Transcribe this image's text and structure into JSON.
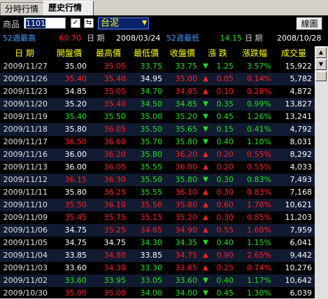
{
  "tabs": [
    {
      "label": "分時行情"
    },
    {
      "label": "歷史行情"
    }
  ],
  "toolbar": {
    "product_label": "商品",
    "code_value": "1101",
    "name_value": "台泥",
    "chart_button": "線圖"
  },
  "stats": {
    "high52_label": "52週最高",
    "high52_value": "60.70",
    "high52_date_label": "日  期",
    "high52_date": "2008/03/24",
    "low52_label": "52週最低",
    "low52_value": "14.15",
    "low52_date_label": "日  期",
    "low52_date": "2008/10/28"
  },
  "columns": [
    "日  期",
    "開盤價",
    "最高價",
    "最低價",
    "收盤價",
    "漲  跌",
    "漲跌幅",
    "成交量"
  ],
  "rows": [
    {
      "date": "2009/11/27",
      "open": "35.00",
      "open_c": "w",
      "high": "35.05",
      "high_c": "r",
      "low": "33.75",
      "low_c": "g",
      "close": "33.75",
      "close_c": "g",
      "dir": "down",
      "chg": "1.25",
      "pct": "3.57%",
      "vol": "15,922"
    },
    {
      "date": "2009/11/26",
      "open": "35.40",
      "open_c": "r",
      "high": "35.40",
      "high_c": "r",
      "low": "34.95",
      "low_c": "w",
      "close": "35.00",
      "close_c": "r",
      "dir": "up",
      "chg": "0.05",
      "pct": "0.14%",
      "vol": "5,782"
    },
    {
      "date": "2009/11/23",
      "open": "34.85",
      "open_c": "w",
      "high": "35.05",
      "high_c": "r",
      "low": "34.70",
      "low_c": "g",
      "close": "34.95",
      "close_c": "r",
      "dir": "up",
      "chg": "0.10",
      "pct": "0.28%",
      "vol": "4,872"
    },
    {
      "date": "2009/11/20",
      "open": "35.20",
      "open_c": "w",
      "high": "35.40",
      "high_c": "r",
      "low": "34.50",
      "low_c": "g",
      "close": "34.85",
      "close_c": "g",
      "dir": "down",
      "chg": "0.35",
      "pct": "0.99%",
      "vol": "13,827"
    },
    {
      "date": "2009/11/19",
      "open": "35.40",
      "open_c": "g",
      "high": "35.50",
      "high_c": "g",
      "low": "35.00",
      "low_c": "g",
      "close": "35.20",
      "close_c": "g",
      "dir": "down",
      "chg": "0.45",
      "pct": "1.26%",
      "vol": "13,241"
    },
    {
      "date": "2009/11/18",
      "open": "35.80",
      "open_c": "w",
      "high": "36.05",
      "high_c": "r",
      "low": "35.50",
      "low_c": "g",
      "close": "35.65",
      "close_c": "g",
      "dir": "down",
      "chg": "0.15",
      "pct": "0.41%",
      "vol": "4,792"
    },
    {
      "date": "2009/11/17",
      "open": "36.50",
      "open_c": "r",
      "high": "36.60",
      "high_c": "r",
      "low": "35.70",
      "low_c": "g",
      "close": "35.80",
      "close_c": "g",
      "dir": "down",
      "chg": "0.40",
      "pct": "1.10%",
      "vol": "8,031"
    },
    {
      "date": "2009/11/16",
      "open": "36.00",
      "open_c": "w",
      "high": "36.20",
      "high_c": "r",
      "low": "35.80",
      "low_c": "g",
      "close": "36.20",
      "close_c": "r",
      "dir": "up",
      "chg": "0.20",
      "pct": "0.55%",
      "vol": "8,292"
    },
    {
      "date": "2009/11/13",
      "open": "36.00",
      "open_c": "w",
      "high": "36.05",
      "high_c": "r",
      "low": "35.55",
      "low_c": "g",
      "close": "36.00",
      "close_c": "r",
      "dir": "up",
      "chg": "0.20",
      "pct": "0.55%",
      "vol": "4,033"
    },
    {
      "date": "2009/11/12",
      "open": "36.15",
      "open_c": "r",
      "high": "36.30",
      "high_c": "r",
      "low": "35.50",
      "low_c": "g",
      "close": "35.80",
      "close_c": "g",
      "dir": "down",
      "chg": "0.30",
      "pct": "0.83%",
      "vol": "7,493"
    },
    {
      "date": "2009/11/11",
      "open": "35.80",
      "open_c": "w",
      "high": "36.25",
      "high_c": "r",
      "low": "35.55",
      "low_c": "g",
      "close": "36.10",
      "close_c": "r",
      "dir": "up",
      "chg": "0.30",
      "pct": "0.83%",
      "vol": "7,168"
    },
    {
      "date": "2009/11/10",
      "open": "35.50",
      "open_c": "r",
      "high": "36.10",
      "high_c": "r",
      "low": "35.50",
      "low_c": "r",
      "close": "35.80",
      "close_c": "r",
      "dir": "up",
      "chg": "0.60",
      "pct": "1.70%",
      "vol": "10,621"
    },
    {
      "date": "2009/11/09",
      "open": "35.45",
      "open_c": "r",
      "high": "35.75",
      "high_c": "r",
      "low": "35.15",
      "low_c": "r",
      "close": "35.20",
      "close_c": "r",
      "dir": "up",
      "chg": "0.30",
      "pct": "0.85%",
      "vol": "11,203"
    },
    {
      "date": "2009/11/06",
      "open": "34.75",
      "open_c": "w",
      "high": "35.25",
      "high_c": "r",
      "low": "34.65",
      "low_c": "r",
      "close": "34.90",
      "close_c": "r",
      "dir": "up",
      "chg": "0.55",
      "pct": "1.60%",
      "vol": "7,959"
    },
    {
      "date": "2009/11/05",
      "open": "34.75",
      "open_c": "w",
      "high": "34.75",
      "high_c": "w",
      "low": "34.30",
      "low_c": "g",
      "close": "34.35",
      "close_c": "g",
      "dir": "down",
      "chg": "0.40",
      "pct": "1.15%",
      "vol": "6,041"
    },
    {
      "date": "2009/11/04",
      "open": "33.85",
      "open_c": "w",
      "high": "34.80",
      "high_c": "r",
      "low": "33.85",
      "low_c": "w",
      "close": "34.75",
      "close_c": "r",
      "dir": "up",
      "chg": "0.90",
      "pct": "2.65%",
      "vol": "9,442"
    },
    {
      "date": "2009/11/03",
      "open": "33.60",
      "open_c": "w",
      "high": "34.30",
      "high_c": "r",
      "low": "33.30",
      "low_c": "g",
      "close": "33.85",
      "close_c": "r",
      "dir": "up",
      "chg": "0.25",
      "pct": "0.74%",
      "vol": "10,276"
    },
    {
      "date": "2009/11/02",
      "open": "33.60",
      "open_c": "g",
      "high": "33.95",
      "high_c": "g",
      "low": "33.05",
      "low_c": "g",
      "close": "33.60",
      "close_c": "g",
      "dir": "down",
      "chg": "0.40",
      "pct": "1.17%",
      "vol": "10,642"
    },
    {
      "date": "2009/10/30",
      "open": "35.00",
      "open_c": "r",
      "high": "35.00",
      "high_c": "r",
      "low": "34.00",
      "low_c": "g",
      "close": "34.00",
      "close_c": "g",
      "dir": "down",
      "chg": "0.45",
      "pct": "1.30%",
      "vol": "6,039"
    }
  ],
  "colors": {
    "up": "#ff2020",
    "down": "#20e020",
    "header": "#ffff00"
  }
}
